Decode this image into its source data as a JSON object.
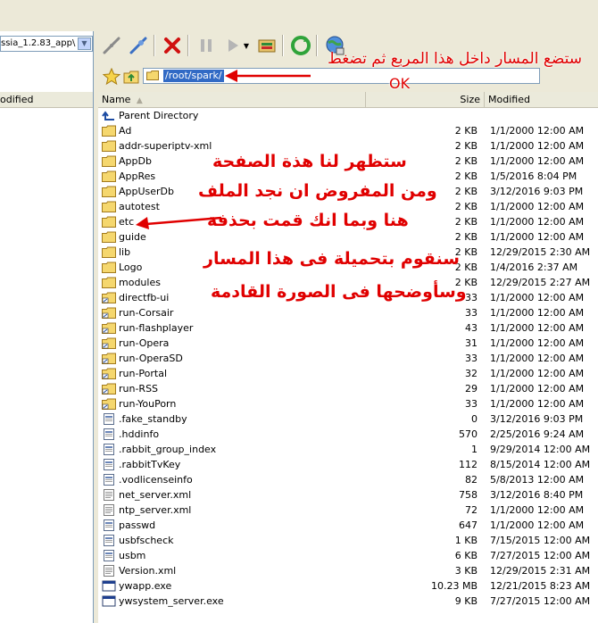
{
  "left_pane": {
    "path_value": "ssia_1.2.83_app\\",
    "column_modified": "odified"
  },
  "address": {
    "path": "/root/spark/"
  },
  "columns": {
    "name": "Name",
    "size": "Size",
    "modified": "Modified"
  },
  "parent_directory": "Parent Directory",
  "files": [
    {
      "name": "Ad",
      "size": "2 KB",
      "modified": "1/1/2000 12:00 AM",
      "type": "folder"
    },
    {
      "name": "addr-superiptv-xml",
      "size": "2 KB",
      "modified": "1/1/2000 12:00 AM",
      "type": "folder"
    },
    {
      "name": "AppDb",
      "size": "2 KB",
      "modified": "1/1/2000 12:00 AM",
      "type": "folder"
    },
    {
      "name": "AppRes",
      "size": "2 KB",
      "modified": "1/5/2016 8:04 PM",
      "type": "folder"
    },
    {
      "name": "AppUserDb",
      "size": "2 KB",
      "modified": "3/12/2016 9:03 PM",
      "type": "folder"
    },
    {
      "name": "autotest",
      "size": "2 KB",
      "modified": "1/1/2000 12:00 AM",
      "type": "folder"
    },
    {
      "name": "etc",
      "size": "2 KB",
      "modified": "1/1/2000 12:00 AM",
      "type": "folder"
    },
    {
      "name": "guide",
      "size": "2 KB",
      "modified": "1/1/2000 12:00 AM",
      "type": "folder"
    },
    {
      "name": "lib",
      "size": "2 KB",
      "modified": "12/29/2015 2:30 AM",
      "type": "folder"
    },
    {
      "name": "Logo",
      "size": "2 KB",
      "modified": "1/4/2016 2:37 AM",
      "type": "folder"
    },
    {
      "name": "modules",
      "size": "2 KB",
      "modified": "12/29/2015 2:27 AM",
      "type": "folder"
    },
    {
      "name": "directfb-ui",
      "size": "33",
      "modified": "1/1/2000 12:00 AM",
      "type": "link"
    },
    {
      "name": "run-Corsair",
      "size": "33",
      "modified": "1/1/2000 12:00 AM",
      "type": "link"
    },
    {
      "name": "run-flashplayer",
      "size": "43",
      "modified": "1/1/2000 12:00 AM",
      "type": "link"
    },
    {
      "name": "run-Opera",
      "size": "31",
      "modified": "1/1/2000 12:00 AM",
      "type": "link"
    },
    {
      "name": "run-OperaSD",
      "size": "33",
      "modified": "1/1/2000 12:00 AM",
      "type": "link"
    },
    {
      "name": "run-Portal",
      "size": "32",
      "modified": "1/1/2000 12:00 AM",
      "type": "link"
    },
    {
      "name": "run-RSS",
      "size": "29",
      "modified": "1/1/2000 12:00 AM",
      "type": "link"
    },
    {
      "name": "run-YouPorn",
      "size": "33",
      "modified": "1/1/2000 12:00 AM",
      "type": "link"
    },
    {
      "name": ".fake_standby",
      "size": "0",
      "modified": "3/12/2016 9:03 PM",
      "type": "file"
    },
    {
      "name": ".hddinfo",
      "size": "570",
      "modified": "2/25/2016 9:24 AM",
      "type": "file"
    },
    {
      "name": ".rabbit_group_index",
      "size": "1",
      "modified": "9/29/2014 12:00 AM",
      "type": "file"
    },
    {
      "name": ".rabbitTvKey",
      "size": "112",
      "modified": "8/15/2014 12:00 AM",
      "type": "file"
    },
    {
      "name": ".vodlicenseinfo",
      "size": "82",
      "modified": "5/8/2013 12:00 AM",
      "type": "file"
    },
    {
      "name": "net_server.xml",
      "size": "758",
      "modified": "3/12/2016 8:40 PM",
      "type": "doc"
    },
    {
      "name": "ntp_server.xml",
      "size": "72",
      "modified": "1/1/2000 12:00 AM",
      "type": "doc"
    },
    {
      "name": "passwd",
      "size": "647",
      "modified": "1/1/2000 12:00 AM",
      "type": "file"
    },
    {
      "name": "usbfscheck",
      "size": "1 KB",
      "modified": "7/15/2015 12:00 AM",
      "type": "file"
    },
    {
      "name": "usbm",
      "size": "6 KB",
      "modified": "7/27/2015 12:00 AM",
      "type": "file"
    },
    {
      "name": "Version.xml",
      "size": "3 KB",
      "modified": "12/29/2015 2:31 AM",
      "type": "doc"
    },
    {
      "name": "ywapp.exe",
      "size": "10.23 MB",
      "modified": "12/21/2015 8:23 AM",
      "type": "exe"
    },
    {
      "name": "ywsystem_server.exe",
      "size": "9 KB",
      "modified": "7/27/2015 12:00 AM",
      "type": "exe"
    }
  ],
  "annotations": {
    "top": "ستضع المسار داخل هذا المربع ثم تضغط",
    "ok": "OK",
    "line1": "ستظهر لنا هذة الصفحة",
    "line2": "ومن المفروض ان نجد الملف",
    "line3": "هنا وبما انك قمت بحذفة",
    "line4": "سنقوم بتحميلة فى هذا المسار",
    "line5": "وسأوضحها فى الصورة القادمة"
  },
  "colors": {
    "annotation": "#e00000",
    "selection": "#316ac5",
    "folder": "#f5d76e"
  },
  "icons": {
    "toolbar": [
      "disconnect-icon",
      "connect-icon",
      "cancel-icon",
      "pause-icon",
      "play-icon",
      "queue-icon",
      "refresh-icon",
      "globe-icon"
    ]
  }
}
